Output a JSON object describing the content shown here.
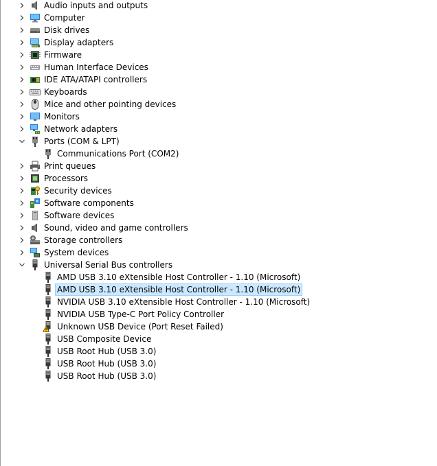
{
  "tree": {
    "categories": [
      {
        "label": "Audio inputs and outputs",
        "icon": "speaker-icon",
        "expanded": false
      },
      {
        "label": "Computer",
        "icon": "computer-icon",
        "expanded": false
      },
      {
        "label": "Disk drives",
        "icon": "disk-drive-icon",
        "expanded": false
      },
      {
        "label": "Display adapters",
        "icon": "display-adapter-icon",
        "expanded": false
      },
      {
        "label": "Firmware",
        "icon": "firmware-icon",
        "expanded": false
      },
      {
        "label": "Human Interface Devices",
        "icon": "hid-icon",
        "expanded": false
      },
      {
        "label": "IDE ATA/ATAPI controllers",
        "icon": "ide-controller-icon",
        "expanded": false
      },
      {
        "label": "Keyboards",
        "icon": "keyboard-icon",
        "expanded": false
      },
      {
        "label": "Mice and other pointing devices",
        "icon": "mouse-icon",
        "expanded": false
      },
      {
        "label": "Monitors",
        "icon": "monitor-icon",
        "expanded": false
      },
      {
        "label": "Network adapters",
        "icon": "network-adapter-icon",
        "expanded": false
      },
      {
        "label": "Ports (COM & LPT)",
        "icon": "port-icon",
        "expanded": true,
        "children": [
          {
            "label": "Communications Port (COM2)",
            "icon": "port-icon"
          }
        ]
      },
      {
        "label": "Print queues",
        "icon": "printer-icon",
        "expanded": false
      },
      {
        "label": "Processors",
        "icon": "processor-icon",
        "expanded": false
      },
      {
        "label": "Security devices",
        "icon": "security-device-icon",
        "expanded": false
      },
      {
        "label": "Software components",
        "icon": "software-component-icon",
        "expanded": false
      },
      {
        "label": "Software devices",
        "icon": "software-device-icon",
        "expanded": false
      },
      {
        "label": "Sound, video and game controllers",
        "icon": "speaker-icon",
        "expanded": false
      },
      {
        "label": "Storage controllers",
        "icon": "storage-controller-icon",
        "expanded": false
      },
      {
        "label": "System devices",
        "icon": "system-device-icon",
        "expanded": false
      },
      {
        "label": "Universal Serial Bus controllers",
        "icon": "usb-icon",
        "expanded": true,
        "children": [
          {
            "label": "AMD USB 3.10 eXtensible Host Controller - 1.10 (Microsoft)",
            "icon": "usb-icon"
          },
          {
            "label": "AMD USB 3.10 eXtensible Host Controller - 1.10 (Microsoft)",
            "icon": "usb-icon",
            "selected": true
          },
          {
            "label": "NVIDIA USB 3.10 eXtensible Host Controller - 1.10 (Microsoft)",
            "icon": "usb-icon"
          },
          {
            "label": "NVIDIA USB Type-C Port Policy Controller",
            "icon": "usb-icon"
          },
          {
            "label": "Unknown USB Device (Port Reset Failed)",
            "icon": "usb-warning-icon"
          },
          {
            "label": "USB Composite Device",
            "icon": "usb-icon"
          },
          {
            "label": "USB Root Hub (USB 3.0)",
            "icon": "usb-icon"
          },
          {
            "label": "USB Root Hub (USB 3.0)",
            "icon": "usb-icon"
          },
          {
            "label": "USB Root Hub (USB 3.0)",
            "icon": "usb-icon"
          }
        ]
      }
    ]
  },
  "colors": {
    "selection_bg": "#cce8ff",
    "selection_border": "#99d1ff",
    "chevron": "#404040",
    "warning": "#f5c400"
  }
}
